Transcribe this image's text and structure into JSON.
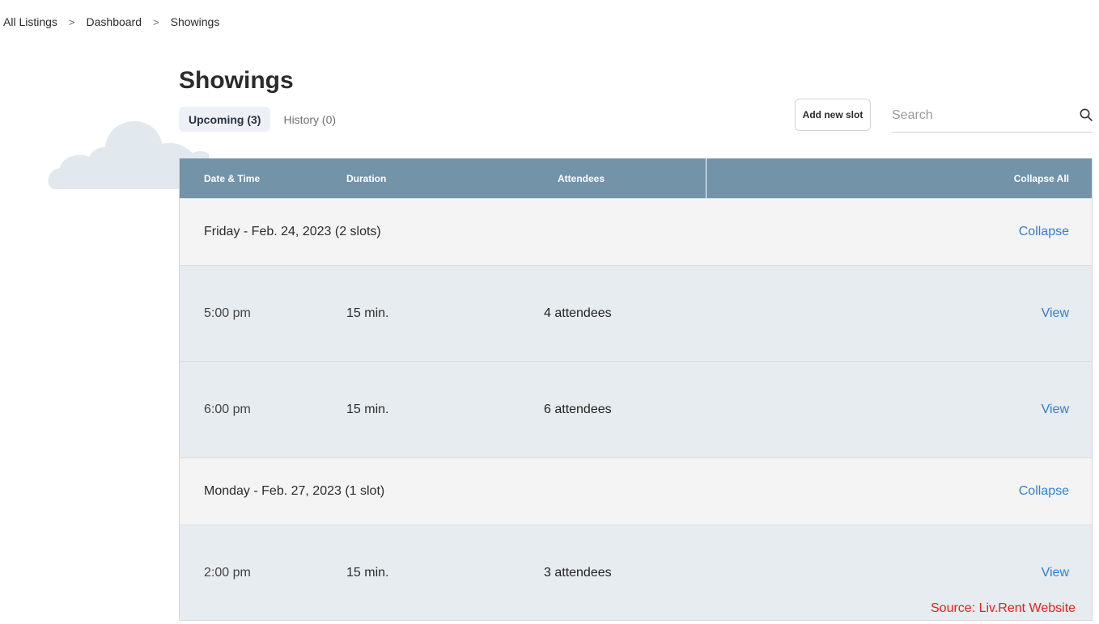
{
  "breadcrumb": {
    "items": [
      "All Listings",
      "Dashboard",
      "Showings"
    ],
    "separator": ">"
  },
  "page": {
    "title": "Showings"
  },
  "tabs": [
    {
      "label": "Upcoming (3)",
      "active": true
    },
    {
      "label": "History (0)",
      "active": false
    }
  ],
  "toolbar": {
    "add_slot_label": "Add new slot",
    "search_placeholder": "Search",
    "search_value": ""
  },
  "table": {
    "headers": {
      "date_time": "Date & Time",
      "duration": "Duration",
      "attendees": "Attendees",
      "collapse_all": "Collapse All"
    },
    "groups": [
      {
        "date": "Friday - Feb. 24, 2023 (2 slots)",
        "collapse_label": "Collapse",
        "slots": [
          {
            "time": "5:00 pm",
            "duration": "15 min.",
            "attendees": "4 attendees",
            "action": "View"
          },
          {
            "time": "6:00 pm",
            "duration": "15 min.",
            "attendees": "6 attendees",
            "action": "View"
          }
        ]
      },
      {
        "date": "Monday - Feb. 27, 2023 (1 slot)",
        "collapse_label": "Collapse",
        "slots": [
          {
            "time": "2:00 pm",
            "duration": "15 min.",
            "attendees": "3 attendees",
            "action": "View"
          }
        ]
      }
    ]
  },
  "source_note": "Source: Liv.Rent Website",
  "colors": {
    "header_bg": "#7393a9",
    "date_row_bg": "#f4f4f4",
    "slot_row_bg": "#e7ecf0",
    "link": "#2f7fd8",
    "source_text": "#e52020",
    "active_tab_bg": "#edf1f7"
  },
  "icons": {
    "search": "search-icon",
    "cloud": "cloud-icon"
  }
}
